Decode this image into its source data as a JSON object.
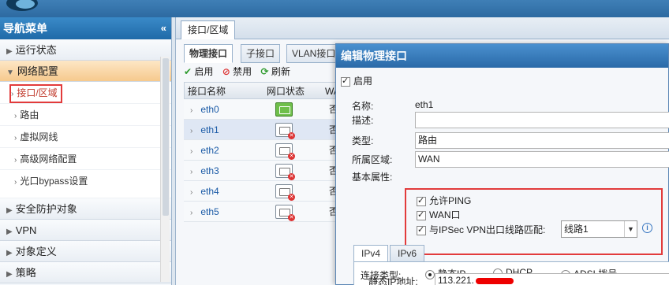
{
  "nav": {
    "title": "导航菜单",
    "collapse_glyph": "«",
    "groups": [
      {
        "label": "运行状态"
      },
      {
        "label": "网络配置"
      },
      {
        "label": "安全防护对象"
      },
      {
        "label": "VPN"
      },
      {
        "label": "对象定义"
      },
      {
        "label": "策略"
      }
    ],
    "network_items": [
      {
        "label": "接口/区域"
      },
      {
        "label": "路由"
      },
      {
        "label": "虚拟网线"
      },
      {
        "label": "高级网络配置"
      },
      {
        "label": "光口bypass设置"
      }
    ]
  },
  "main_tab": "接口/区域",
  "subtabs": [
    "物理接口",
    "子接口",
    "VLAN接口"
  ],
  "toolbar": {
    "enable": "启用",
    "disable": "禁用",
    "refresh": "刷新"
  },
  "grid": {
    "headers": {
      "name": "接口名称",
      "status": "网口状态",
      "wan": "WA"
    },
    "rows": [
      {
        "name": "eth0",
        "status": "up",
        "wan": "否"
      },
      {
        "name": "eth1",
        "status": "down",
        "wan": "否"
      },
      {
        "name": "eth2",
        "status": "down",
        "wan": "否"
      },
      {
        "name": "eth3",
        "status": "down",
        "wan": "否"
      },
      {
        "name": "eth4",
        "status": "down",
        "wan": "否"
      },
      {
        "name": "eth5",
        "status": "down",
        "wan": "否"
      }
    ]
  },
  "dialog": {
    "title": "编辑物理接口",
    "enable_label": "启用",
    "name_label": "名称:",
    "name_value": "eth1",
    "desc_label": "描述:",
    "desc_value": "",
    "type_label": "类型:",
    "type_value": "路由",
    "zone_label": "所属区域:",
    "zone_value": "WAN",
    "basic_label": "基本属性:",
    "allow_ping": "允许PING",
    "wan_port": "WAN口",
    "ipsec_match": "与IPSec VPN出口线路匹配:",
    "line_select": "线路1",
    "ip_tabs": [
      "IPv4",
      "IPv6"
    ],
    "conn_type_label": "连接类型:",
    "conn_static": "静态IP",
    "conn_dhcp": "DHCP",
    "conn_adsl": "ADSL拨号",
    "static_ip_label": "静态IP地址:",
    "static_ip_value": "113.221."
  }
}
